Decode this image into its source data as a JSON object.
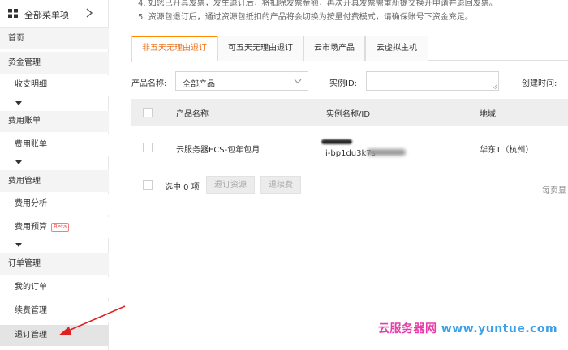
{
  "sidebar": {
    "header": "全部菜单项",
    "home": "首页",
    "groups": {
      "funds": "资金管理",
      "billing": "费用账单",
      "cost": "费用管理",
      "orders": "订单管理"
    },
    "items": {
      "income_detail": "收支明细",
      "fee_bill": "费用账单",
      "fee_analysis": "费用分析",
      "fee_budget": "费用预算",
      "my_orders": "我的订单",
      "renew": "续费管理",
      "unsubscribe": "退订管理"
    },
    "beta_badge": "Beta"
  },
  "notices": {
    "line4": "4. 如您已开具发票，发生退订后，将扣除发票金额，再次开具发票需重新提交换开申请并退回发票。",
    "line5": "5. 资源包退订后，通过资源包抵扣的产品将会切换为按量付费模式，请确保账号下资金充足。"
  },
  "tabs": [
    {
      "label": "非五天无理由退订"
    },
    {
      "label": "可五天无理由退订"
    },
    {
      "label": "云市场产品"
    },
    {
      "label": "云虚拟主机"
    }
  ],
  "filters": {
    "product_label": "产品名称:",
    "product_value": "全部产品",
    "instance_label": "实例ID:",
    "instance_value": "",
    "created_label": "创建时间:"
  },
  "table": {
    "headers": [
      "产品名称",
      "实例名称/ID",
      "地域"
    ],
    "rows": [
      {
        "product": "云服务器ECS-包年包月",
        "instance_id": "i-bp1du3k7s",
        "region": "华东1（杭州）"
      }
    ]
  },
  "footer": {
    "selected": "选中 0 项",
    "unsubscribe_btn": "退订资源",
    "refund_btn": "退续费",
    "per_page": "每页显"
  },
  "watermark": {
    "brand": "云服务器网",
    "url": "www.yuntue.com"
  },
  "colors": {
    "accent": "#ff8a00",
    "annotation_arrow": "#e02020"
  }
}
